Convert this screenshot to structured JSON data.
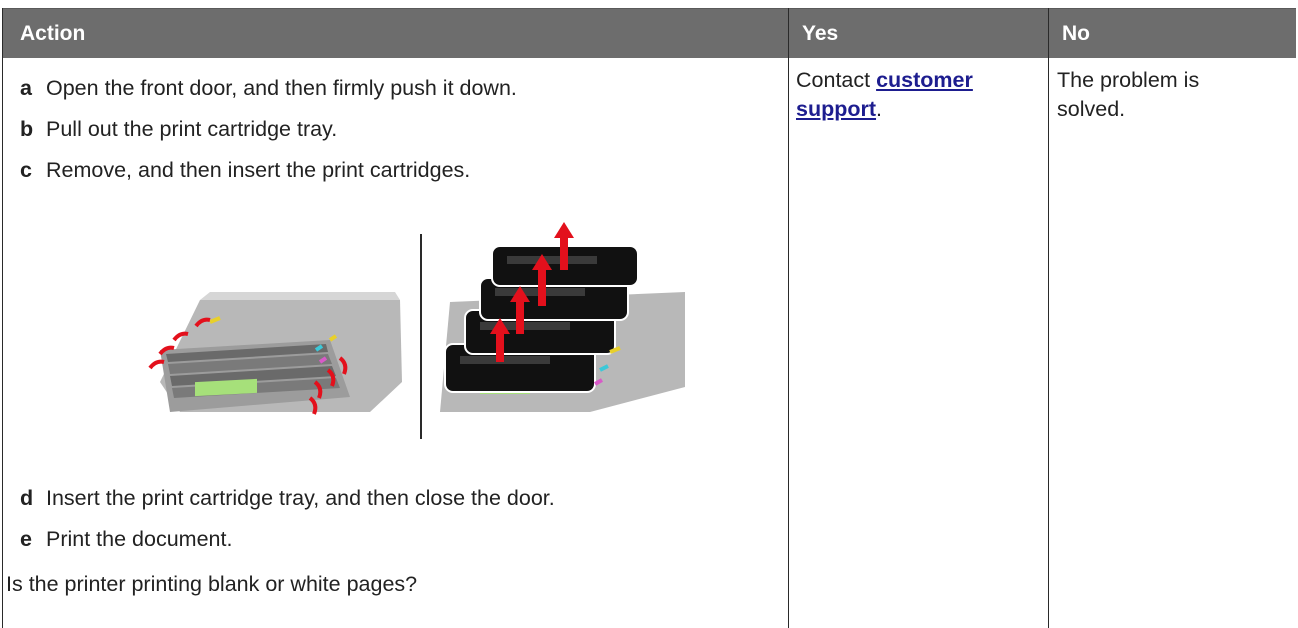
{
  "header": {
    "action": "Action",
    "yes": "Yes",
    "no": "No"
  },
  "steps": [
    {
      "letter": "a",
      "text": "Open the front door, and then firmly push it down."
    },
    {
      "letter": "b",
      "text": "Pull out the print cartridge tray."
    },
    {
      "letter": "c",
      "text": "Remove, and then insert the print cartridges."
    },
    {
      "letter": "d",
      "text": "Insert the print cartridge tray, and then close the door."
    },
    {
      "letter": "e",
      "text": "Print the document."
    }
  ],
  "question": "Is the printer printing blank or white pages?",
  "yes_cell": {
    "prefix": "Contact ",
    "link1": "customer",
    "link2": "support",
    "suffix": "."
  },
  "no_cell": {
    "line1": "The problem is",
    "line2": "solved."
  },
  "colors": {
    "header_bg": "#6d6d6d",
    "link": "#1d1d8f",
    "arrow": "#e3101c"
  }
}
